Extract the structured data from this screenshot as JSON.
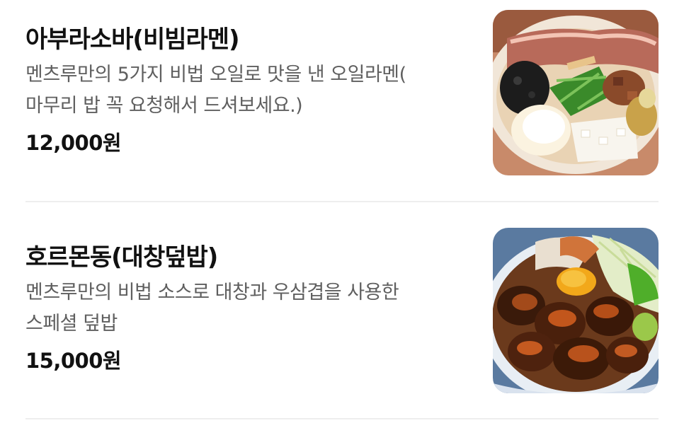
{
  "menu": {
    "items": [
      {
        "name": "아부라소바(비빔라멘)",
        "description_lines": [
          "멘츠루만의 5가지 비법 오일로 맛을 낸 오일라멘(",
          "마무리 밥 꼭 요청해서 드셔보세요.)"
        ],
        "price": "12,000원",
        "photo_subject": "abura-soba-bowl"
      },
      {
        "name": "호르몬동(대창덮밥)",
        "description_lines": [
          "멘츠루만의 비법 소스로 대창과 우삼겹을 사용한",
          "스페셜 덮밥"
        ],
        "price": "15,000원",
        "photo_subject": "hormone-don-bowl"
      }
    ]
  },
  "colors": {
    "text_primary": "#111111",
    "text_secondary": "#5f5f5f",
    "divider": "#eeeeee",
    "background": "#ffffff"
  }
}
